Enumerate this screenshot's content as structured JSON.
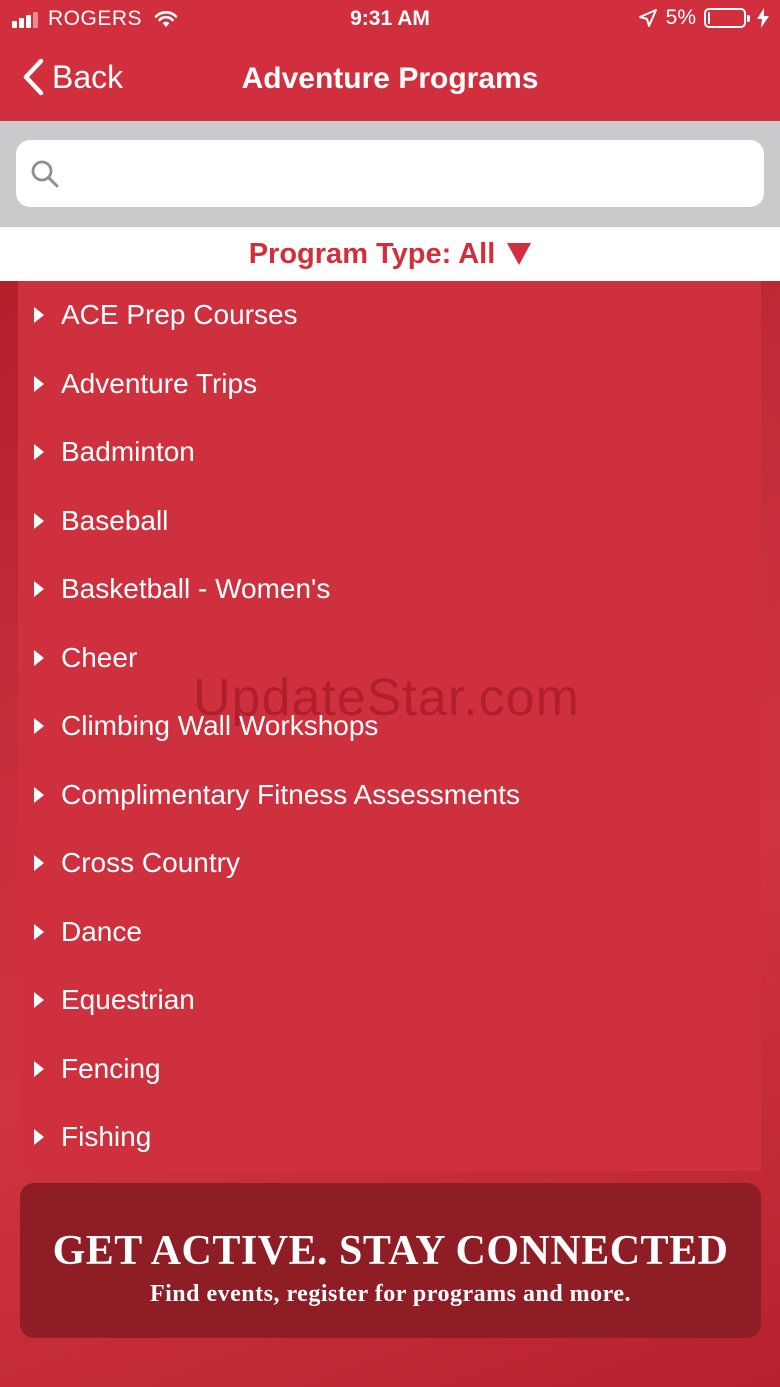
{
  "status_bar": {
    "carrier": "ROGERS",
    "time": "9:31 AM",
    "battery_percent": "5%",
    "battery_level": 0.05
  },
  "nav": {
    "back_label": "Back",
    "title": "Adventure Programs"
  },
  "search": {
    "placeholder": "",
    "value": ""
  },
  "filter": {
    "label": "Program Type: All"
  },
  "programs": [
    {
      "label": "ACE Prep Courses"
    },
    {
      "label": "Adventure Trips"
    },
    {
      "label": "Badminton"
    },
    {
      "label": "Baseball"
    },
    {
      "label": "Basketball - Women's"
    },
    {
      "label": "Cheer"
    },
    {
      "label": "Climbing Wall Workshops"
    },
    {
      "label": "Complimentary Fitness Assessments"
    },
    {
      "label": "Cross Country"
    },
    {
      "label": "Dance"
    },
    {
      "label": "Equestrian"
    },
    {
      "label": "Fencing"
    },
    {
      "label": "Fishing"
    }
  ],
  "watermark": "UpdateStar.com",
  "banner": {
    "headline": "GET ACTIVE.  STAY CONNECTED",
    "subline": "Find events, register for programs and more."
  },
  "colors": {
    "brand_red": "#d12f3e",
    "banner_dark_red": "#8e1d25",
    "search_bg": "#cacacc"
  },
  "icons": {
    "signal": "signal-bars-icon",
    "wifi": "wifi-icon",
    "location": "location-arrow-icon",
    "battery": "battery-icon",
    "charging": "charging-bolt-icon",
    "back": "chevron-left-icon",
    "search": "search-icon",
    "filter": "triangle-down-icon",
    "list": "caret-right-icon"
  }
}
